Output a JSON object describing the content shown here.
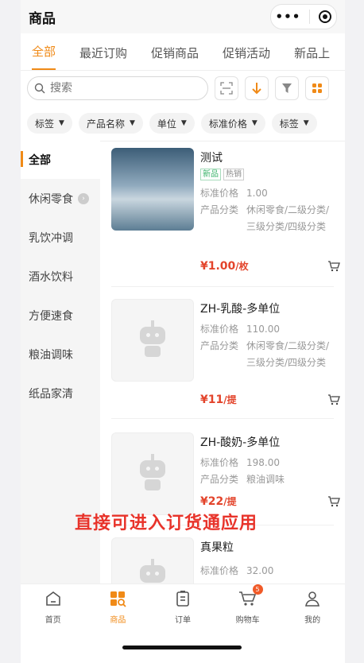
{
  "app": {
    "title": "商品"
  },
  "tabs": [
    "全部",
    "最近订购",
    "促销商品",
    "促销活动",
    "新品上"
  ],
  "search": {
    "placeholder": "搜索"
  },
  "filters": [
    "标签",
    "产品名称",
    "单位",
    "标准价格",
    "标签"
  ],
  "categories": [
    "全部",
    "休闲零食",
    "乳饮冲调",
    "酒水饮料",
    "方便速食",
    "粮油调味",
    "纸品家清"
  ],
  "labels": {
    "std_price": "标准价格",
    "category": "产品分类"
  },
  "products": [
    {
      "name": "测试",
      "tags": [
        "新品",
        "热销"
      ],
      "std_price": "1.00",
      "category": "休闲零食/二级分类/三级分类/四级分类",
      "price": "¥1.00",
      "unit": "/枚"
    },
    {
      "name": "ZH-乳酸-多单位",
      "tags": [],
      "std_price": "110.00",
      "category": "休闲零食/二级分类/三级分类/四级分类",
      "price": "¥11",
      "unit": "/提"
    },
    {
      "name": "ZH-酸奶-多单位",
      "tags": [],
      "std_price": "198.00",
      "category": "粮油调味",
      "price": "¥22",
      "unit": "/提"
    },
    {
      "name": "真果粒",
      "tags": [],
      "std_price": "32.00",
      "category": "",
      "price": "",
      "unit": ""
    }
  ],
  "overlay_text": "直接可进入订货通应用",
  "bottom_nav": [
    {
      "label": "首页",
      "icon": "home-icon"
    },
    {
      "label": "商品",
      "icon": "products-icon"
    },
    {
      "label": "订单",
      "icon": "orders-icon"
    },
    {
      "label": "购物车",
      "icon": "cart-icon",
      "badge": "5"
    },
    {
      "label": "我的",
      "icon": "profile-icon"
    }
  ],
  "colors": {
    "accent": "#f08a17",
    "price": "#e3442b",
    "overlay": "#e8332a"
  }
}
